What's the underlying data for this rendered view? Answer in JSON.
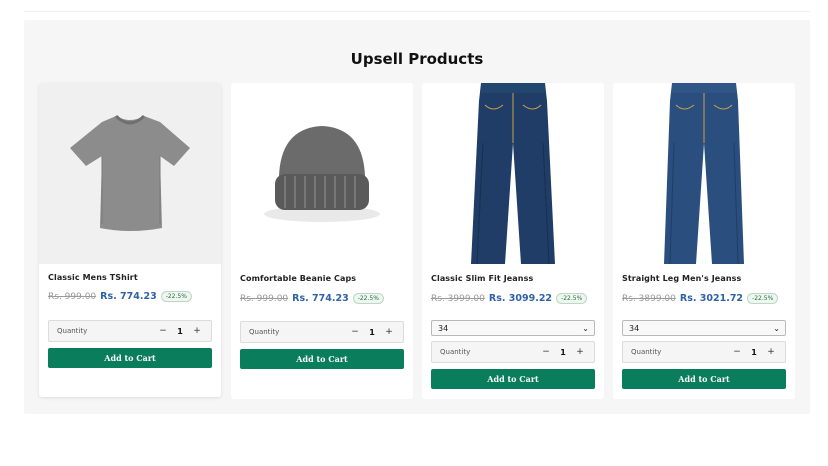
{
  "section": {
    "title": "Upsell Products"
  },
  "products": [
    {
      "name": "Classic Mens TShirt",
      "old_price": "Rs. 999.00",
      "new_price": "Rs. 774.23",
      "discount": "-22.5%",
      "quantity_label": "Quantity",
      "quantity": "1",
      "add_label": "Add to Cart",
      "image_icon": "tshirt-image"
    },
    {
      "name": "Comfortable Beanie Caps",
      "old_price": "Rs. 999.00",
      "new_price": "Rs. 774.23",
      "discount": "-22.5%",
      "quantity_label": "Quantity",
      "quantity": "1",
      "add_label": "Add to Cart",
      "image_icon": "beanie-image"
    },
    {
      "name": "Classic Slim Fit Jeanss",
      "old_price": "Rs. 3999.00",
      "new_price": "Rs. 3099.22",
      "discount": "-22.5%",
      "size": "34",
      "quantity_label": "Quantity",
      "quantity": "1",
      "add_label": "Add to Cart",
      "image_icon": "jeans-image"
    },
    {
      "name": "Straight Leg Men's Jeanss",
      "old_price": "Rs. 3899.00",
      "new_price": "Rs. 3021.72",
      "discount": "-22.5%",
      "size": "34",
      "quantity_label": "Quantity",
      "quantity": "1",
      "add_label": "Add to Cart",
      "image_icon": "jeans-image"
    }
  ],
  "colors": {
    "add_to_cart": "#0a7d5d",
    "sale_price": "#2f62a8",
    "badge_text": "#2b6a44"
  }
}
